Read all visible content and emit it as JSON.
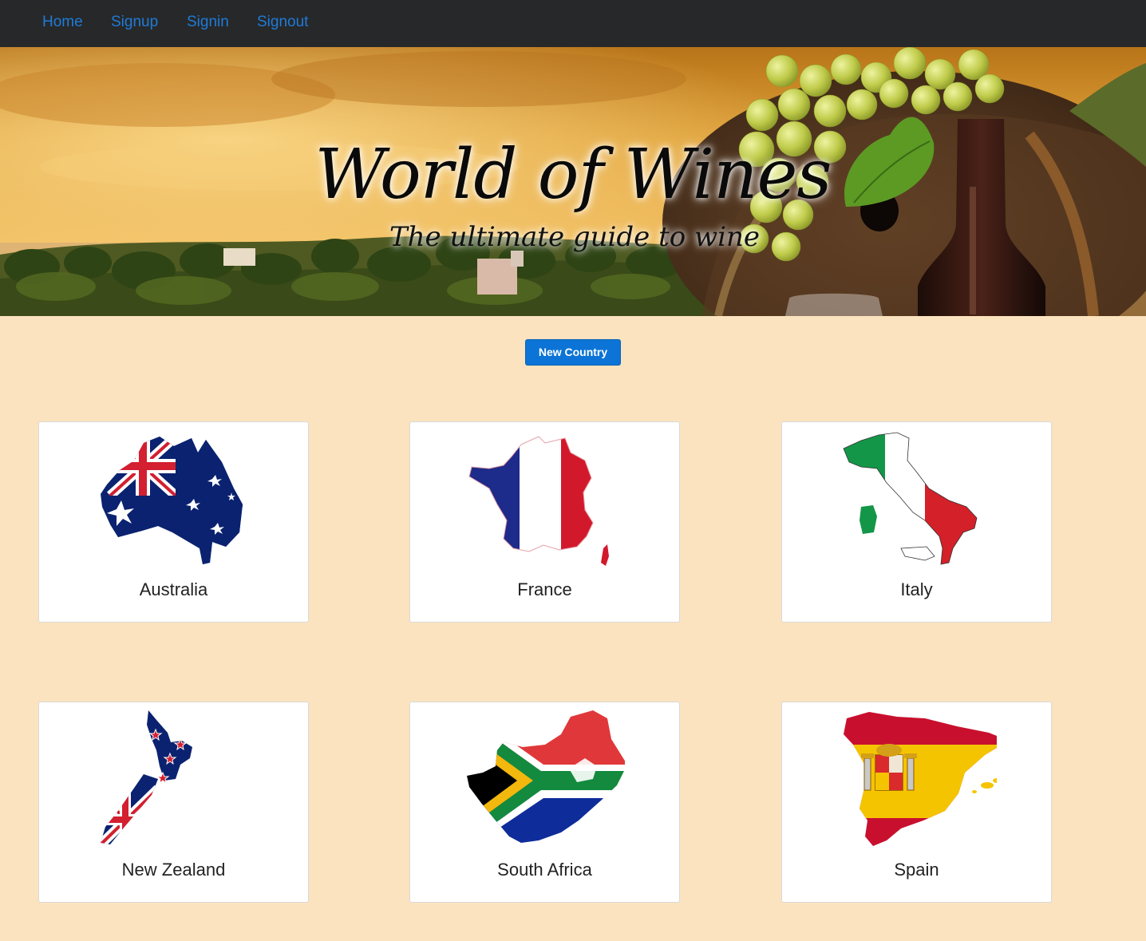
{
  "nav": {
    "items": [
      {
        "label": "Home"
      },
      {
        "label": "Signup"
      },
      {
        "label": "Signin"
      },
      {
        "label": "Signout"
      }
    ],
    "link_color": "#1f7bd6",
    "background": "#27282a"
  },
  "hero": {
    "title": "World of Wines",
    "subtitle": "The ultimate guide to wine"
  },
  "actions": {
    "new_country_label": "New Country",
    "button_color": "#0c74d6"
  },
  "countries": [
    {
      "name": "Australia",
      "icon": "australia-flag-map-icon"
    },
    {
      "name": "France",
      "icon": "france-flag-map-icon"
    },
    {
      "name": "Italy",
      "icon": "italy-flag-map-icon"
    },
    {
      "name": "New Zealand",
      "icon": "new-zealand-flag-map-icon"
    },
    {
      "name": "South Africa",
      "icon": "south-africa-flag-map-icon"
    },
    {
      "name": "Spain",
      "icon": "spain-flag-map-icon"
    }
  ],
  "page_background": "#fbe3bf"
}
